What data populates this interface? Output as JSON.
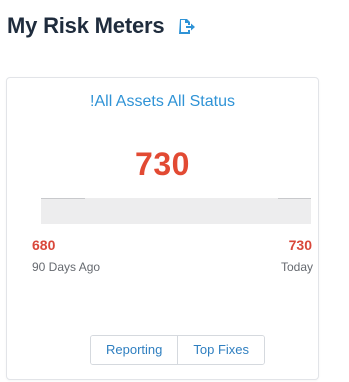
{
  "header": {
    "title": "My Risk Meters",
    "export_icon": "export-icon",
    "accent_color": "#2f93d6"
  },
  "card": {
    "title": "!All Assets All Status",
    "score": "730",
    "score_color": "#e24a33",
    "start": {
      "value": "680",
      "label": "90 Days Ago"
    },
    "end": {
      "value": "730",
      "label": "Today"
    },
    "buttons": {
      "reporting": "Reporting",
      "top_fixes": "Top Fixes"
    }
  }
}
